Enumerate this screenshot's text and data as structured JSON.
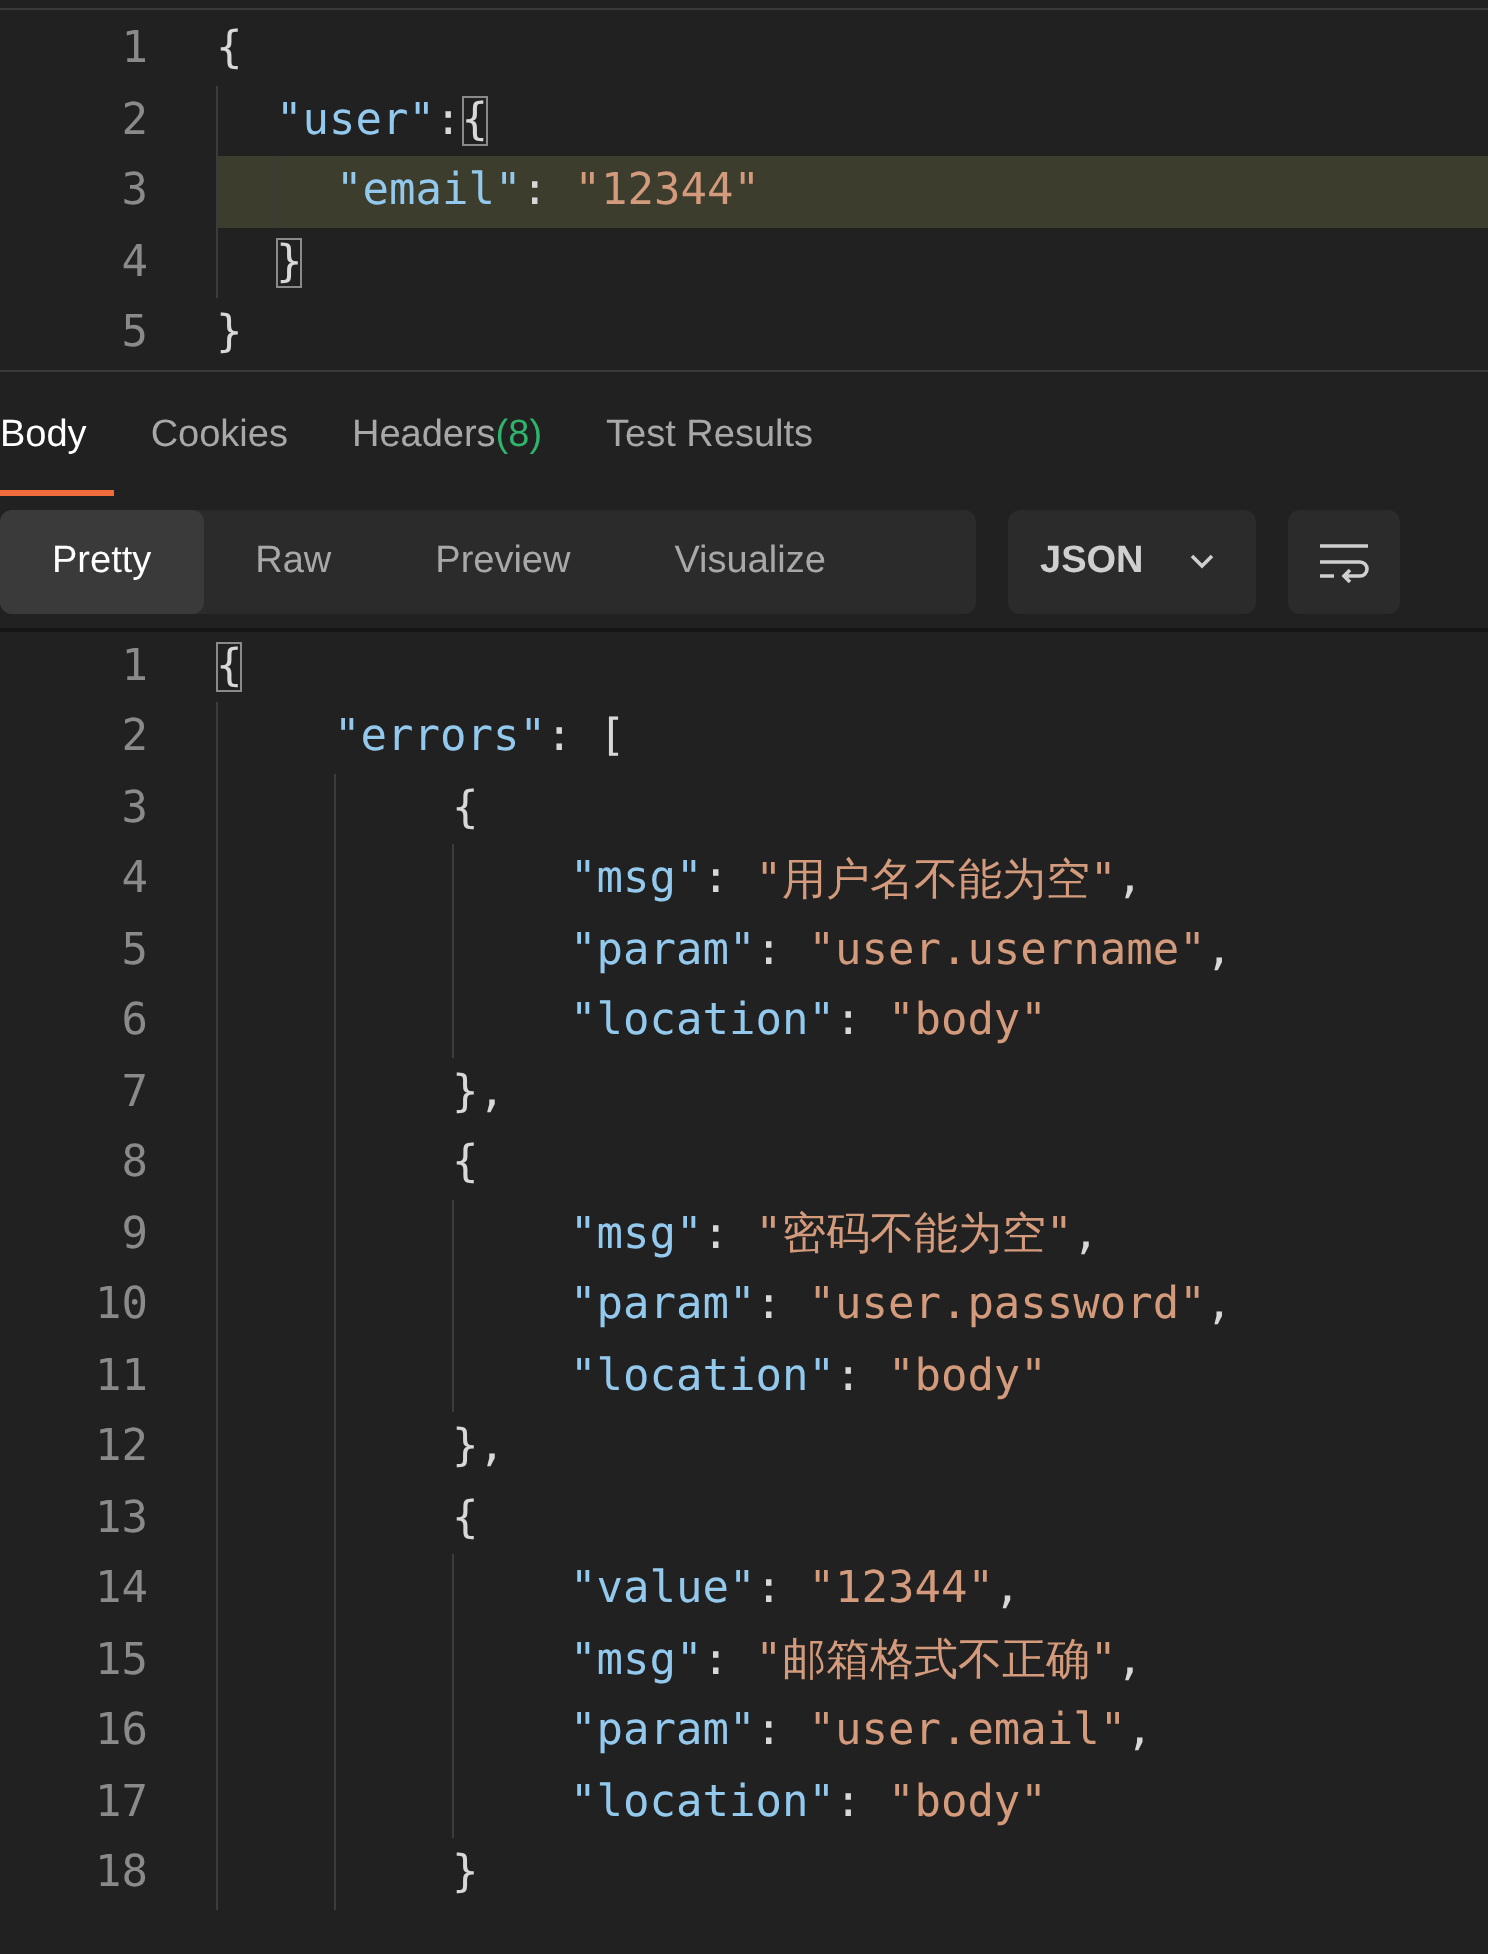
{
  "request_editor": {
    "lines": [
      {
        "number": "1",
        "highlighted": false,
        "match": false,
        "tokens": [
          {
            "kind": "open",
            "text": "{"
          }
        ]
      },
      {
        "number": "2",
        "highlighted": false,
        "match": true,
        "tokens": [
          {
            "kind": "key",
            "text": "\"user\""
          },
          {
            "kind": "punct",
            "text": ":"
          },
          {
            "kind": "open",
            "text": "{"
          }
        ]
      },
      {
        "number": "3",
        "highlighted": true,
        "match": false,
        "tokens": [
          {
            "kind": "key",
            "text": "\"email\""
          },
          {
            "kind": "punct",
            "text": ": "
          },
          {
            "kind": "string",
            "text": "\"12344\""
          }
        ]
      },
      {
        "number": "4",
        "highlighted": false,
        "match": true,
        "tokens": [
          {
            "kind": "close",
            "text": "}"
          }
        ]
      },
      {
        "number": "5",
        "highlighted": false,
        "match": false,
        "tokens": [
          {
            "kind": "close",
            "text": "}"
          }
        ]
      }
    ]
  },
  "response_tabs": [
    {
      "label": "Body",
      "selected": true
    },
    {
      "label": "Cookies",
      "selected": false
    },
    {
      "label": "Headers",
      "count": "(8)",
      "selected": false
    },
    {
      "label": "Test Results",
      "selected": false
    }
  ],
  "view_modes": [
    {
      "label": "Pretty",
      "selected": true
    },
    {
      "label": "Raw",
      "selected": false
    },
    {
      "label": "Preview",
      "selected": false
    },
    {
      "label": "Visualize",
      "selected": false
    }
  ],
  "format_dropdown": {
    "value": "JSON"
  },
  "response_editor": {
    "lines": [
      {
        "number": "1",
        "highlighted": false,
        "match": true,
        "tokens": [
          {
            "kind": "open",
            "text": "{"
          }
        ]
      },
      {
        "number": "2",
        "highlighted": false,
        "match": false,
        "tokens": [
          {
            "kind": "key",
            "text": "\"errors\""
          },
          {
            "kind": "punct",
            "text": ": "
          },
          {
            "kind": "open",
            "text": "["
          }
        ]
      },
      {
        "number": "3",
        "highlighted": false,
        "match": false,
        "tokens": [
          {
            "kind": "open",
            "text": "{"
          }
        ]
      },
      {
        "number": "4",
        "highlighted": false,
        "match": false,
        "tokens": [
          {
            "kind": "key",
            "text": "\"msg\""
          },
          {
            "kind": "punct",
            "text": ": "
          },
          {
            "kind": "string",
            "text": "\"用户名不能为空\""
          },
          {
            "kind": "punct",
            "text": ","
          }
        ]
      },
      {
        "number": "5",
        "highlighted": false,
        "match": false,
        "tokens": [
          {
            "kind": "key",
            "text": "\"param\""
          },
          {
            "kind": "punct",
            "text": ": "
          },
          {
            "kind": "string",
            "text": "\"user.username\""
          },
          {
            "kind": "punct",
            "text": ","
          }
        ]
      },
      {
        "number": "6",
        "highlighted": false,
        "match": false,
        "tokens": [
          {
            "kind": "key",
            "text": "\"location\""
          },
          {
            "kind": "punct",
            "text": ": "
          },
          {
            "kind": "string",
            "text": "\"body\""
          }
        ]
      },
      {
        "number": "7",
        "highlighted": false,
        "match": false,
        "tokens": [
          {
            "kind": "close",
            "text": "}"
          },
          {
            "kind": "punct",
            "text": ","
          }
        ]
      },
      {
        "number": "8",
        "highlighted": false,
        "match": false,
        "tokens": [
          {
            "kind": "open",
            "text": "{"
          }
        ]
      },
      {
        "number": "9",
        "highlighted": false,
        "match": false,
        "tokens": [
          {
            "kind": "key",
            "text": "\"msg\""
          },
          {
            "kind": "punct",
            "text": ": "
          },
          {
            "kind": "string",
            "text": "\"密码不能为空\""
          },
          {
            "kind": "punct",
            "text": ","
          }
        ]
      },
      {
        "number": "10",
        "highlighted": false,
        "match": false,
        "tokens": [
          {
            "kind": "key",
            "text": "\"param\""
          },
          {
            "kind": "punct",
            "text": ": "
          },
          {
            "kind": "string",
            "text": "\"user.password\""
          },
          {
            "kind": "punct",
            "text": ","
          }
        ]
      },
      {
        "number": "11",
        "highlighted": false,
        "match": false,
        "tokens": [
          {
            "kind": "key",
            "text": "\"location\""
          },
          {
            "kind": "punct",
            "text": ": "
          },
          {
            "kind": "string",
            "text": "\"body\""
          }
        ]
      },
      {
        "number": "12",
        "highlighted": false,
        "match": false,
        "tokens": [
          {
            "kind": "close",
            "text": "}"
          },
          {
            "kind": "punct",
            "text": ","
          }
        ]
      },
      {
        "number": "13",
        "highlighted": false,
        "match": false,
        "tokens": [
          {
            "kind": "open",
            "text": "{"
          }
        ]
      },
      {
        "number": "14",
        "highlighted": false,
        "match": false,
        "tokens": [
          {
            "kind": "key",
            "text": "\"value\""
          },
          {
            "kind": "punct",
            "text": ": "
          },
          {
            "kind": "string",
            "text": "\"12344\""
          },
          {
            "kind": "punct",
            "text": ","
          }
        ]
      },
      {
        "number": "15",
        "highlighted": false,
        "match": false,
        "tokens": [
          {
            "kind": "key",
            "text": "\"msg\""
          },
          {
            "kind": "punct",
            "text": ": "
          },
          {
            "kind": "string",
            "text": "\"邮箱格式不正确\""
          },
          {
            "kind": "punct",
            "text": ","
          }
        ]
      },
      {
        "number": "16",
        "highlighted": false,
        "match": false,
        "tokens": [
          {
            "kind": "key",
            "text": "\"param\""
          },
          {
            "kind": "punct",
            "text": ": "
          },
          {
            "kind": "string",
            "text": "\"user.email\""
          },
          {
            "kind": "punct",
            "text": ","
          }
        ]
      },
      {
        "number": "17",
        "highlighted": false,
        "match": false,
        "tokens": [
          {
            "kind": "key",
            "text": "\"location\""
          },
          {
            "kind": "punct",
            "text": ": "
          },
          {
            "kind": "string",
            "text": "\"body\""
          }
        ]
      },
      {
        "number": "18",
        "highlighted": false,
        "match": false,
        "tokens": [
          {
            "kind": "close",
            "text": "}"
          }
        ]
      }
    ]
  }
}
